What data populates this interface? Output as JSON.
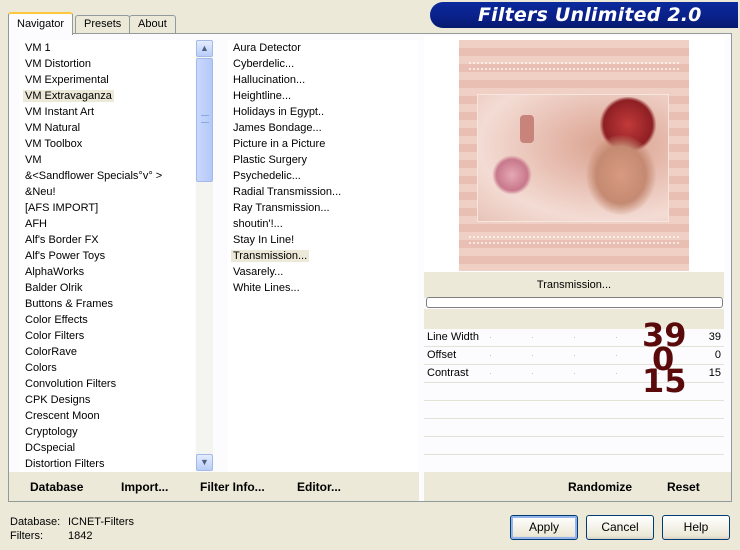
{
  "tabs": [
    {
      "label": "Navigator",
      "active": true
    },
    {
      "label": "Presets",
      "active": false
    },
    {
      "label": "About",
      "active": false
    }
  ],
  "title": "Filters Unlimited 2.0",
  "categories": [
    "VM 1",
    "VM Distortion",
    "VM Experimental",
    "VM Extravaganza",
    "VM Instant Art",
    "VM Natural",
    "VM Toolbox",
    "VM",
    "&<Sandflower Specials°v° >",
    "&Neu!",
    "[AFS IMPORT]",
    "AFH",
    "Alf's Border FX",
    "Alf's Power Toys",
    "AlphaWorks",
    "Balder Olrik",
    "Buttons & Frames",
    "Color Effects",
    "Color Filters",
    "ColorRave",
    "Colors",
    "Convolution Filters",
    "CPK Designs",
    "Crescent Moon",
    "Cryptology",
    "DCspecial",
    "Distortion Filters"
  ],
  "selected_category": "VM Extravaganza",
  "filters": [
    "Aura Detector",
    "Cyberdelic...",
    "Hallucination...",
    "Heightline...",
    "Holidays in Egypt..",
    "James Bondage...",
    "Picture in a Picture",
    "Plastic Surgery",
    "Psychedelic...",
    "Radial Transmission...",
    "Ray Transmission...",
    "shoutin'!...",
    "Stay In Line!",
    "Transmission...",
    "Vasarely...",
    "White Lines..."
  ],
  "selected_filter": "Transmission...",
  "preview_filter_name": "Transmission...",
  "progress_fraction": 0,
  "params": [
    {
      "label": "Line Width",
      "value": "39",
      "big": "39"
    },
    {
      "label": "Offset",
      "value": "0",
      "big": "0"
    },
    {
      "label": "Contrast",
      "value": "15",
      "big": "15"
    }
  ],
  "links": {
    "database": "Database",
    "import": "Import...",
    "filter_info": "Filter Info...",
    "editor": "Editor...",
    "randomize": "Randomize",
    "reset": "Reset"
  },
  "footer": {
    "database_label": "Database:",
    "database_value": "ICNET-Filters",
    "filters_label": "Filters:",
    "filters_value": "1842"
  },
  "buttons": {
    "apply": "Apply",
    "cancel": "Cancel",
    "help": "Help"
  },
  "colors": {
    "banner": "#0a2088",
    "selection": "#ece9d8",
    "big_numbers": "#5a0a0a"
  },
  "icons": {
    "scroll_up": "scroll-up-arrow-icon",
    "scroll_down": "scroll-down-arrow-icon"
  }
}
